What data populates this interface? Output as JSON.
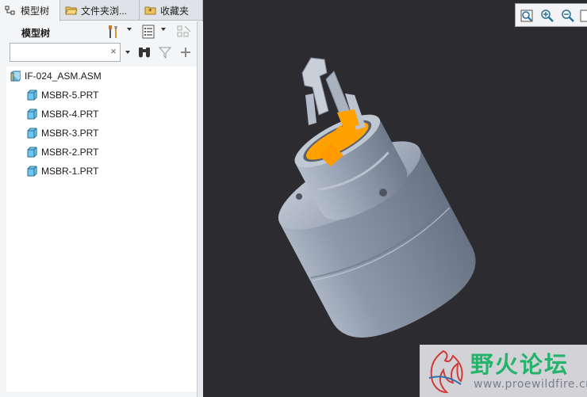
{
  "tabs": [
    {
      "label": "模型树",
      "icon": "model-tree-icon",
      "active": true
    },
    {
      "label": "文件夹浏...",
      "icon": "folder-browser-icon",
      "active": false
    },
    {
      "label": "收藏夹",
      "icon": "favorites-icon",
      "active": false
    }
  ],
  "tree_panel": {
    "title": "模型树",
    "settings_icon": "tools-icon",
    "show_icon": "tree-columns-icon",
    "filter_icon": "filter-icon",
    "find_icon": "binoculars-icon",
    "add_icon": "plus-icon"
  },
  "search": {
    "value": "",
    "placeholder": "",
    "clear_label": "×"
  },
  "tree": {
    "root": {
      "label": "IF-024_ASM.ASM",
      "icon": "assembly-icon"
    },
    "items": [
      {
        "label": "MSBR-5.PRT",
        "icon": "part-icon"
      },
      {
        "label": "MSBR-4.PRT",
        "icon": "part-icon"
      },
      {
        "label": "MSBR-3.PRT",
        "icon": "part-icon"
      },
      {
        "label": "MSBR-2.PRT",
        "icon": "part-icon"
      },
      {
        "label": "MSBR-1.PRT",
        "icon": "part-icon"
      }
    ]
  },
  "view_toolbar": {
    "buttons": [
      "refit-icon",
      "zoom-in-icon",
      "zoom-out-icon",
      "repaint-icon"
    ]
  },
  "viewport": {
    "background": "#2b2b30",
    "model_color": "#8f9aab",
    "highlight_color": "#ffa200"
  },
  "watermark": {
    "title": "野火论坛",
    "url": "www.proewildfire.cn",
    "title_color": "#24b36b"
  }
}
